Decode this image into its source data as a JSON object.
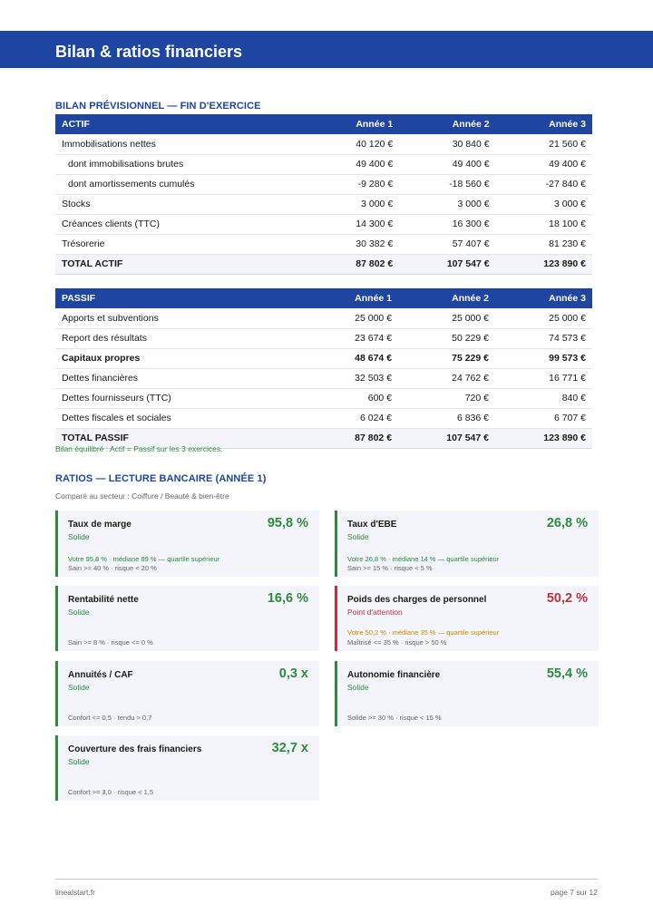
{
  "header": {
    "title": "Bilan & ratios financiers"
  },
  "bilan": {
    "section_title": "BILAN PRÉVISIONNEL — FIN D'EXERCICE",
    "actif": {
      "headers": [
        "ACTIF",
        "Année 1",
        "Année 2",
        "Année 3"
      ],
      "rows": [
        {
          "label": "Immobilisations nettes",
          "v": [
            "40 120 €",
            "30 840 €",
            "21 560 €"
          ]
        },
        {
          "label": "dont immobilisations brutes",
          "v": [
            "49 400 €",
            "49 400 €",
            "49 400 €"
          ]
        },
        {
          "label": "dont amortissements cumulés",
          "v": [
            "-9 280 €",
            "-18 560 €",
            "-27 840 €"
          ]
        },
        {
          "label": "Stocks",
          "v": [
            "3 000 €",
            "3 000 €",
            "3 000 €"
          ]
        },
        {
          "label": "Créances clients (TTC)",
          "v": [
            "14 300 €",
            "16 300 €",
            "18 100 €"
          ]
        },
        {
          "label": "Trésorerie",
          "v": [
            "30 382 €",
            "57 407 €",
            "81 230 €"
          ]
        },
        {
          "label": "TOTAL ACTIF",
          "v": [
            "87 802 €",
            "107 547 €",
            "123 890 €"
          ]
        }
      ]
    },
    "passif": {
      "headers": [
        "PASSIF",
        "Année 1",
        "Année 2",
        "Année 3"
      ],
      "rows": [
        {
          "label": "Apports et subventions",
          "v": [
            "25 000 €",
            "25 000 €",
            "25 000 €"
          ]
        },
        {
          "label": "Report des résultats",
          "v": [
            "23 674 €",
            "50 229 €",
            "74 573 €"
          ]
        },
        {
          "label": "Capitaux propres",
          "v": [
            "48 674 €",
            "75 229 €",
            "99 573 €"
          ]
        },
        {
          "label": "Dettes financières",
          "v": [
            "32 503 €",
            "24 762 €",
            "16 771 €"
          ]
        },
        {
          "label": "Dettes fournisseurs (TTC)",
          "v": [
            "600 €",
            "720 €",
            "840 €"
          ]
        },
        {
          "label": "Dettes fiscales et sociales",
          "v": [
            "6 024 €",
            "6 836 €",
            "6 707 €"
          ]
        },
        {
          "label": "TOTAL PASSIF",
          "v": [
            "87 802 €",
            "107 547 €",
            "123 890 €"
          ]
        }
      ]
    },
    "note": "Bilan équilibré : Actif = Passif sur les 3 exercices."
  },
  "ratios": {
    "section_title": "RATIOS — LECTURE BANCAIRE (ANNÉE 1)",
    "subtitle": "Comparé au secteur : Coiffure / Beauté & bien-être",
    "cards": [
      {
        "name": "Taux de marge",
        "value": "95,8 %",
        "status": "Solide",
        "line1": "Votre 95,8 % · médiane 89 % — quartile supérieur",
        "line2": "Sain >= 40 % · risque < 20 %"
      },
      {
        "name": "Taux d'EBE",
        "value": "26,8 %",
        "status": "Solide",
        "line1": "Votre 26,8 % · médiane 14 % — quartile supérieur",
        "line2": "Sain >= 15 % · risque < 5 %"
      },
      {
        "name": "Rentabilité nette",
        "value": "16,6 %",
        "status": "Solide",
        "line1": "",
        "line2": "Sain >= 8 % · risque <= 0 %"
      },
      {
        "name": "Poids des charges de personnel",
        "value": "50,2 %",
        "status": "Point d'attention",
        "line1": "Votre 50,2 % · médiane 35 % — quartile supérieur",
        "line2": "Maîtrisé <= 35 % · risque > 50 %"
      },
      {
        "name": "Annuités / CAF",
        "value": "0,3 x",
        "status": "Solide",
        "line1": "",
        "line2": "Confort <= 0,5 · tendu > 0,7"
      },
      {
        "name": "Autonomie financière",
        "value": "55,4 %",
        "status": "Solide",
        "line1": "",
        "line2": "Solide >= 30 % · risque < 15 %"
      },
      {
        "name": "Couverture des frais financiers",
        "value": "32,7 x",
        "status": "Solide",
        "line1": "",
        "line2": "Confort >= 3,0 · risque < 1,5"
      }
    ]
  },
  "footer": {
    "site": "linealstart.fr",
    "page": "page 7 sur 12"
  },
  "colors": {
    "brand": "#1e45a0",
    "good": "#2e8b3e",
    "alert": "#c0303a",
    "warn_text": "#d08a00"
  }
}
